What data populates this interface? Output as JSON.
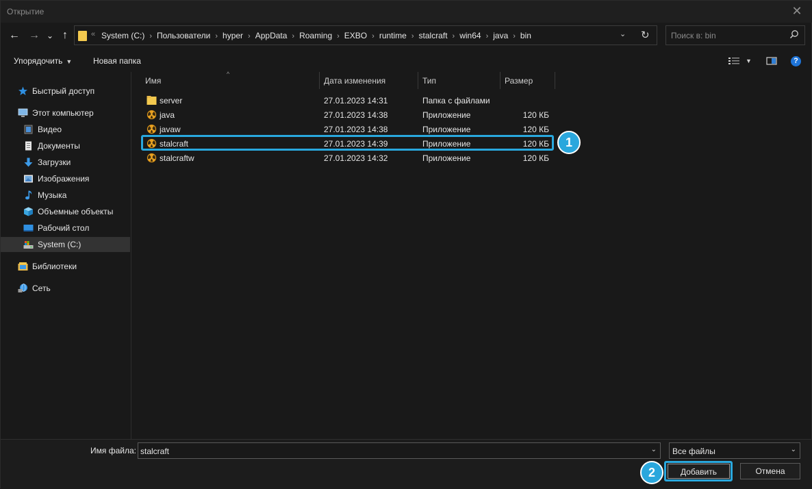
{
  "window": {
    "title": "Открытие",
    "close_glyph": "✕"
  },
  "nav": {
    "back_glyph": "←",
    "forward_glyph": "→",
    "recent_glyph": "⌄",
    "up_glyph": "↑"
  },
  "address": {
    "overflow_glyph": "«",
    "crumbs": [
      "System (C:)",
      "Пользователи",
      "hyper",
      "AppData",
      "Roaming",
      "EXBO",
      "runtime",
      "stalcraft",
      "win64",
      "java",
      "bin"
    ],
    "separator": "›",
    "dropdown_glyph": "⌄",
    "refresh_glyph": "↻"
  },
  "search": {
    "placeholder": "Поиск в: bin",
    "icon": "search-icon"
  },
  "toolbar": {
    "organize_label": "Упорядочить",
    "caret": "▼",
    "new_folder_label": "Новая папка",
    "help_label": "?"
  },
  "sidebar": {
    "items": [
      {
        "label": "Быстрый доступ",
        "icon": "star-icon"
      },
      {
        "label": "Этот компьютер",
        "icon": "computer-icon"
      },
      {
        "label": "Видео",
        "icon": "video-icon"
      },
      {
        "label": "Документы",
        "icon": "documents-icon"
      },
      {
        "label": "Загрузки",
        "icon": "download-icon"
      },
      {
        "label": "Изображения",
        "icon": "pictures-icon"
      },
      {
        "label": "Музыка",
        "icon": "music-icon"
      },
      {
        "label": "Объемные объекты",
        "icon": "3d-objects-icon"
      },
      {
        "label": "Рабочий стол",
        "icon": "desktop-icon"
      },
      {
        "label": "System (C:)",
        "icon": "drive-icon"
      },
      {
        "label": "Библиотеки",
        "icon": "libraries-icon"
      },
      {
        "label": "Сеть",
        "icon": "network-icon"
      }
    ]
  },
  "columns": {
    "name": "Имя",
    "date": "Дата изменения",
    "type": "Тип",
    "size": "Размер",
    "sort_glyph": "^"
  },
  "files": [
    {
      "name": "server",
      "date": "27.01.2023 14:31",
      "type": "Папка с файлами",
      "size": "",
      "icon": "folder-icon"
    },
    {
      "name": "java",
      "date": "27.01.2023 14:38",
      "type": "Приложение",
      "size": "120 КБ",
      "icon": "app-icon"
    },
    {
      "name": "javaw",
      "date": "27.01.2023 14:38",
      "type": "Приложение",
      "size": "120 КБ",
      "icon": "app-icon"
    },
    {
      "name": "stalcraft",
      "date": "27.01.2023 14:39",
      "type": "Приложение",
      "size": "120 КБ",
      "icon": "app-icon"
    },
    {
      "name": "stalcraftw",
      "date": "27.01.2023 14:32",
      "type": "Приложение",
      "size": "120 КБ",
      "icon": "app-icon"
    }
  ],
  "annotations": {
    "badge1": "1",
    "badge2": "2",
    "accent": "#29a8de"
  },
  "footer": {
    "filename_label": "Имя файла:",
    "filename_value": "stalcraft",
    "filetype_value": "Все файлы",
    "dropdown_glyph": "⌄",
    "add_label": "Добавить",
    "cancel_label": "Отмена"
  }
}
